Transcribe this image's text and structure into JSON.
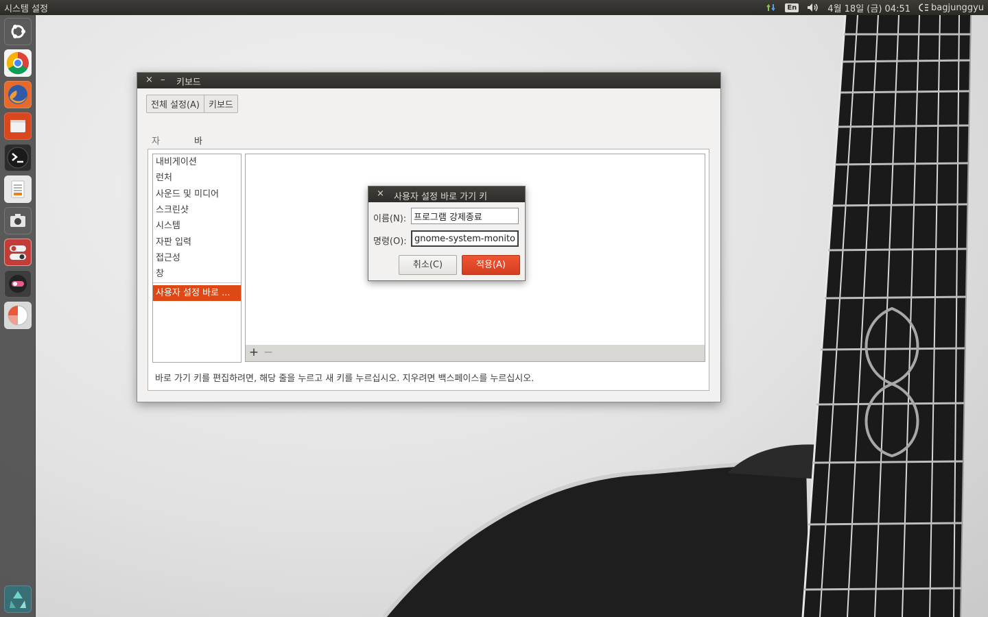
{
  "top_panel": {
    "app_title": "시스템 설정",
    "input_method": "En",
    "datetime": "4월 18일 (금) 04:51",
    "username": "bagjunggyu"
  },
  "launcher": {
    "items": [
      {
        "name": "dash-home",
        "icon": "ubuntu-logo-icon",
        "color": "#5a5a5a"
      },
      {
        "name": "chrome",
        "icon": "chrome-icon",
        "color": "#f4f4f4"
      },
      {
        "name": "firefox",
        "icon": "firefox-icon",
        "color": "#e66a2c"
      },
      {
        "name": "files",
        "icon": "folder-icon",
        "color": "#d9471f"
      },
      {
        "name": "terminal",
        "icon": "terminal-icon",
        "color": "#2c2c2c"
      },
      {
        "name": "text-editor",
        "icon": "text-editor-icon",
        "color": "#e9e9e9"
      },
      {
        "name": "screenshot",
        "icon": "camera-icon",
        "color": "#5c5c5c"
      },
      {
        "name": "system-settings",
        "icon": "settings-toggle-icon",
        "color": "#c33c37"
      },
      {
        "name": "recorder",
        "icon": "record-icon",
        "color": "#3d3d3d"
      },
      {
        "name": "disk-usage",
        "icon": "pie-chart-icon",
        "color": "#d9d9d9"
      },
      {
        "name": "trash",
        "icon": "recycle-icon",
        "color": "#3a6e77"
      }
    ]
  },
  "keyboard_window": {
    "title": "키보드",
    "close_glyph": "×",
    "minimize_glyph": "–",
    "top_tabs": [
      "전체 설정(A)",
      "키보드"
    ],
    "inner_tabs": [
      "자판 입력",
      "바로 가기"
    ],
    "categories": [
      "내비게이션",
      "런처",
      "사운드 및 미디어",
      "스크린샷",
      "시스템",
      "자판 입력",
      "접근성",
      "창"
    ],
    "custom_category": "사용자 설정 바로 ...",
    "add_glyph": "+",
    "remove_glyph": "−",
    "hint": "바로 가기 키를 편집하려면, 해당 줄을 누르고 새 키를 누르십시오. 지우려면 백스페이스를 누르십시오."
  },
  "dialog": {
    "title": "사용자 설정 바로 가기 키",
    "close_glyph": "×",
    "name_label": "이름(N):",
    "name_value": "프로그램 강제종료",
    "command_label": "명령(O):",
    "command_value": "gnome-system-monitor",
    "cancel_label": "취소(C)",
    "apply_label": "적용(A)"
  },
  "colors": {
    "accent": "#dd4814",
    "panel": "#2b2a27"
  }
}
